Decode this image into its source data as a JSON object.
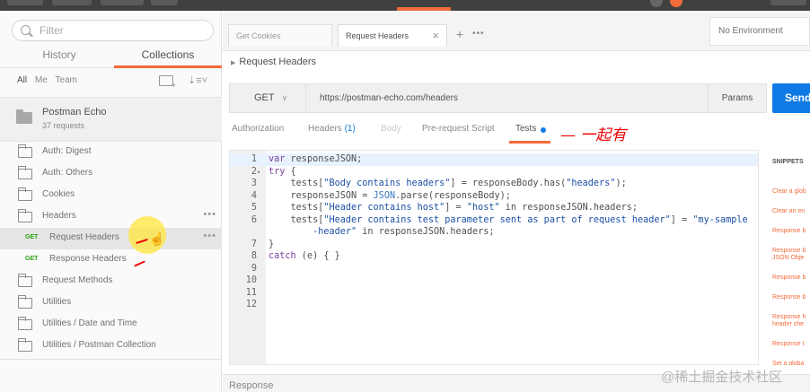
{
  "sidebar": {
    "filter_placeholder": "Filter",
    "tabs": [
      {
        "label": "History",
        "active": false
      },
      {
        "label": "Collections",
        "active": true
      }
    ],
    "filters": [
      "All",
      "Me",
      "Team"
    ],
    "collection": {
      "name": "Postman Echo",
      "count": "37 requests"
    },
    "tree": [
      {
        "type": "folder",
        "label": "Auth: Digest"
      },
      {
        "type": "folder",
        "label": "Auth: Others"
      },
      {
        "type": "folder",
        "label": "Cookies"
      },
      {
        "type": "folder-open",
        "label": "Headers"
      },
      {
        "type": "request",
        "method": "GET",
        "label": "Request Headers",
        "selected": true
      },
      {
        "type": "request",
        "method": "GET",
        "label": "Response Headers"
      },
      {
        "type": "folder",
        "label": "Request Methods"
      },
      {
        "type": "folder",
        "label": "Utilities"
      },
      {
        "type": "folder",
        "label": "Utilities / Date and Time"
      },
      {
        "type": "folder",
        "label": "Utilities / Postman Collection"
      }
    ],
    "more_dots": "•••"
  },
  "tabs": {
    "items": [
      {
        "label": "Get Cookies",
        "active": false
      },
      {
        "label": "Request Headers",
        "active": true
      }
    ],
    "close_symbol": "×",
    "add_symbol": "+",
    "more_symbol": "•••"
  },
  "environment": "No Environment",
  "breadcrumb": "Request Headers",
  "request": {
    "method": "GET",
    "url": "https://postman-echo.com/headers",
    "params_label": "Params",
    "send_label": "Send"
  },
  "subtabs": [
    {
      "label": "Authorization",
      "state": "normal"
    },
    {
      "label": "Headers",
      "count": "(1)",
      "state": "normal"
    },
    {
      "label": "Body",
      "state": "disabled"
    },
    {
      "label": "Pre-request Script",
      "state": "normal"
    },
    {
      "label": "Tests",
      "state": "active"
    }
  ],
  "annotation": "一起有",
  "code_lines": [
    {
      "n": "1",
      "fold": "",
      "html": "<span class='kw'>var</span> responseJSON;"
    },
    {
      "n": "2",
      "fold": "▾",
      "html": "<span class='kw'>try</span> {"
    },
    {
      "n": "3",
      "fold": "",
      "html": "    tests[<span class='str'>\"Body contains headers\"</span>] = responseBody.has(<span class='str'>\"headers\"</span>);"
    },
    {
      "n": "4",
      "fold": "",
      "html": "    responseJSON = <span class='cls'>JSON</span>.parse(responseBody);"
    },
    {
      "n": "5",
      "fold": "",
      "html": "    tests[<span class='str'>\"Header contains host\"</span>] = <span class='str'>\"host\"</span> in responseJSON.headers;"
    },
    {
      "n": "6",
      "fold": "",
      "html": "    tests[<span class='str'>\"Header contains test parameter sent as part of request header\"</span>] = <span class='str'>\"my-sample</span>"
    },
    {
      "n": "",
      "fold": "",
      "html": "        <span class='str'>-header\"</span> in responseJSON.headers;"
    },
    {
      "n": "7",
      "fold": "",
      "html": "}"
    },
    {
      "n": "8",
      "fold": "",
      "html": "<span class='kw'>catch</span> (e) { }"
    },
    {
      "n": "9",
      "fold": "",
      "html": ""
    },
    {
      "n": "10",
      "fold": "",
      "html": ""
    },
    {
      "n": "11",
      "fold": "",
      "html": ""
    },
    {
      "n": "12",
      "fold": "",
      "html": ""
    }
  ],
  "snippets": {
    "title": "SNIPPETS",
    "items": [
      {
        "lines": [
          "Clear a glob"
        ]
      },
      {
        "lines": [
          "Clear an en"
        ]
      },
      {
        "lines": [
          "Response b"
        ]
      },
      {
        "lines": [
          "Response b",
          "JSON Obje"
        ]
      },
      {
        "lines": [
          "Response b"
        ]
      },
      {
        "lines": [
          "Response b"
        ]
      },
      {
        "lines": [
          "Response h",
          "header che"
        ]
      },
      {
        "lines": [
          "Response t"
        ]
      },
      {
        "lines": [
          "Set a globa"
        ]
      }
    ]
  },
  "response_label": "Response",
  "watermark": "@稀土掘金技术社区",
  "colors": {
    "accent": "#f26b3a",
    "primary": "#0f7ae5",
    "get_method": "#2aa10f",
    "annotation_red": "#e00000"
  }
}
